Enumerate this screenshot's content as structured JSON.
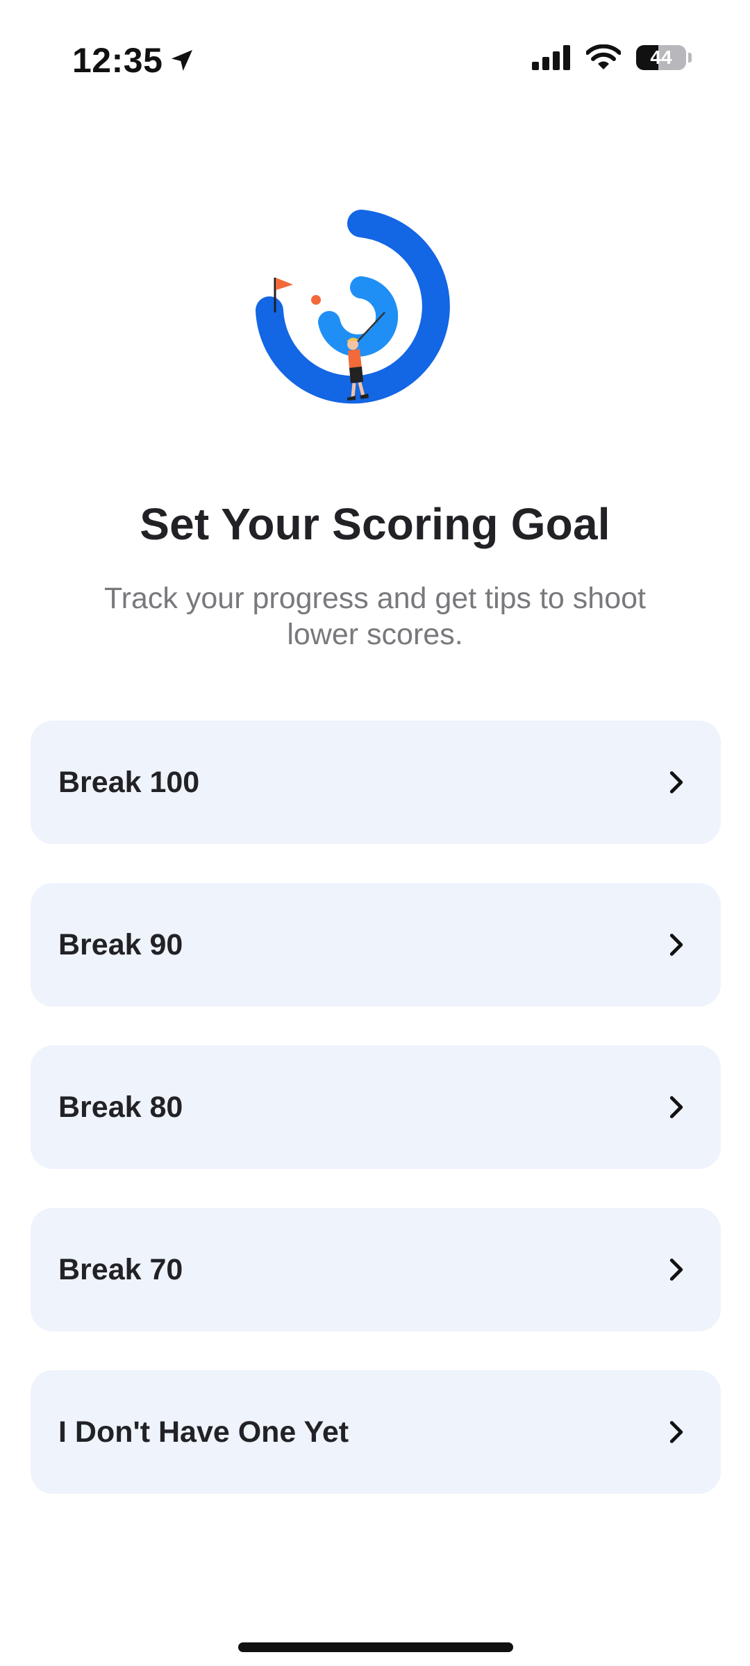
{
  "status_bar": {
    "time": "12:35",
    "battery_level": "44",
    "battery_fraction": 0.44
  },
  "screen": {
    "title": "Set Your Scoring Goal",
    "subtitle": "Track your progress and get tips to shoot lower scores."
  },
  "options": [
    {
      "label": "Break 100"
    },
    {
      "label": "Break 90"
    },
    {
      "label": "Break 80"
    },
    {
      "label": "Break 70"
    },
    {
      "label": "I Don't Have One Yet"
    }
  ],
  "colors": {
    "outer_ring": "#1366e4",
    "inner_ring": "#1f8ff5",
    "card_bg": "#eef3fc",
    "flag": "#f26a3a"
  }
}
